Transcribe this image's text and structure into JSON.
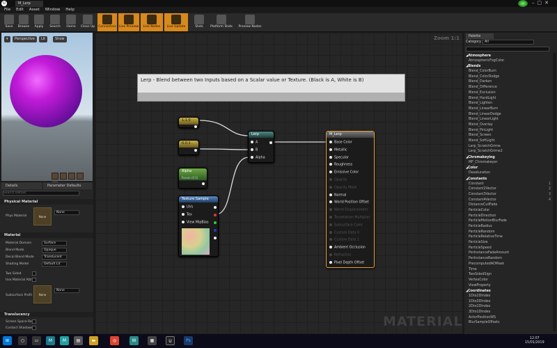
{
  "window": {
    "tab_title": "M_Lerp"
  },
  "menu": [
    "File",
    "Edit",
    "Asset",
    "Window",
    "Help"
  ],
  "toolbar": [
    {
      "label": "Save",
      "icon": "save-icon",
      "active": false
    },
    {
      "label": "Browse",
      "icon": "browse-icon",
      "active": false
    },
    {
      "label": "Apply",
      "icon": "apply-icon",
      "active": false
    },
    {
      "label": "Search",
      "icon": "search-icon",
      "active": false
    },
    {
      "label": "Home",
      "icon": "home-icon",
      "active": false
    },
    {
      "label": "Clean Up",
      "icon": "cleanup-icon",
      "active": false
    },
    {
      "label": "Connectors",
      "icon": "connectors-icon",
      "active": true
    },
    {
      "label": "Live Preview",
      "icon": "live-preview-icon",
      "active": true
    },
    {
      "label": "Live Nodes",
      "icon": "live-nodes-icon",
      "active": true
    },
    {
      "label": "Live Update",
      "icon": "live-update-icon",
      "active": true
    },
    {
      "label": "Stats",
      "icon": "stats-icon",
      "active": false
    },
    {
      "label": "Platform Stats",
      "icon": "platform-stats-icon",
      "active": false
    },
    {
      "label": "Preview Nodes",
      "icon": "preview-nodes-icon",
      "active": false
    }
  ],
  "viewport": {
    "perspective": "Perspective",
    "lit": "Lit",
    "show": "Show"
  },
  "details": {
    "tab_details": "Details",
    "tab_param": "Parameter Defaults",
    "search_placeholder": "Search Details",
    "sections": {
      "physical": "Physical Material",
      "material": "Material",
      "translucency": "Translucency"
    },
    "phys_material_label": "Phys Material",
    "none": "None",
    "props": [
      {
        "label": "Material Domain",
        "value": "Surface"
      },
      {
        "label": "Blend Mode",
        "value": "Opaque"
      },
      {
        "label": "Decal Blend Mode",
        "value": "Translucent"
      },
      {
        "label": "Shading Model",
        "value": "Default Lit"
      }
    ],
    "checks": [
      "Two Sided",
      "Use Material Attri"
    ],
    "subsurface_label": "Subsurface Profil",
    "trans_checks": [
      "Screen Space Ref",
      "Contact Shadows"
    ]
  },
  "graph": {
    "zoom": "Zoom 1:1",
    "watermark": "MATERIAL",
    "comment": "Lerp - Blend between two Inputs based on a Scalar value or Texture.  (Black is A, White is B)",
    "const1": {
      "title": "1,1,0"
    },
    "const2": {
      "title": "0,0,1"
    },
    "alpha": {
      "title": "Alpha",
      "subtitle": "Param (0.5)"
    },
    "texture": {
      "title": "Texture Sample",
      "pins": [
        "UVs",
        "Tex",
        "View MipBias"
      ]
    },
    "lerp": {
      "title": "Lerp",
      "pins": [
        "A",
        "B",
        "Alpha"
      ]
    },
    "result": {
      "title": "M_Lerp",
      "pins": [
        {
          "label": "Base Color",
          "active": true
        },
        {
          "label": "Metallic",
          "active": true
        },
        {
          "label": "Specular",
          "active": true
        },
        {
          "label": "Roughness",
          "active": true
        },
        {
          "label": "Emissive Color",
          "active": true
        },
        {
          "label": "Opacity",
          "active": false
        },
        {
          "label": "Opacity Mask",
          "active": false
        },
        {
          "label": "Normal",
          "active": true
        },
        {
          "label": "World Position Offset",
          "active": true
        },
        {
          "label": "World Displacement",
          "active": false
        },
        {
          "label": "Tessellation Multiplier",
          "active": false
        },
        {
          "label": "Subsurface Color",
          "active": false
        },
        {
          "label": "Custom Data 0",
          "active": false
        },
        {
          "label": "Custom Data 1",
          "active": false
        },
        {
          "label": "Ambient Occlusion",
          "active": true
        },
        {
          "label": "Refraction",
          "active": false
        },
        {
          "label": "Pixel Depth Offset",
          "active": true
        }
      ]
    }
  },
  "palette": {
    "tab": "Palette",
    "category_label": "Category",
    "category_value": "All",
    "items": [
      {
        "t": "Atmosphere",
        "cat": true
      },
      {
        "t": "AtmosphericFogColor"
      },
      {
        "t": "Blends",
        "cat": true
      },
      {
        "t": "Blend_ColorBurn"
      },
      {
        "t": "Blend_ColorDodge"
      },
      {
        "t": "Blend_Darken"
      },
      {
        "t": "Blend_Difference"
      },
      {
        "t": "Blend_Exclusion"
      },
      {
        "t": "Blend_HardLight"
      },
      {
        "t": "Blend_Lighten"
      },
      {
        "t": "Blend_LinearBurn"
      },
      {
        "t": "Blend_LinearDodge"
      },
      {
        "t": "Blend_LinearLight"
      },
      {
        "t": "Blend_Overlay"
      },
      {
        "t": "Blend_PinLight"
      },
      {
        "t": "Blend_Screen"
      },
      {
        "t": "Blend_SoftLight"
      },
      {
        "t": "Lerp_ScratchGrime"
      },
      {
        "t": "Lerp_ScratchGrime2"
      },
      {
        "t": "Chromakeying",
        "cat": true
      },
      {
        "t": "MF_Chromakeyer"
      },
      {
        "t": "Color",
        "cat": true
      },
      {
        "t": "Desaturation"
      },
      {
        "t": "Constants",
        "cat": true
      },
      {
        "t": "Constant",
        "k": "1"
      },
      {
        "t": "Constant2Vector",
        "k": "2"
      },
      {
        "t": "Constant3Vector",
        "k": "3"
      },
      {
        "t": "Constant4Vector",
        "k": "4"
      },
      {
        "t": "DistanceCullFade"
      },
      {
        "t": "ParticleColor"
      },
      {
        "t": "ParticleDirection"
      },
      {
        "t": "ParticleMotionBlurFade"
      },
      {
        "t": "ParticleRadius"
      },
      {
        "t": "ParticleRandom"
      },
      {
        "t": "ParticleRelativeTime"
      },
      {
        "t": "ParticleSize"
      },
      {
        "t": "ParticleSpeed"
      },
      {
        "t": "PerInstanceFadeAmount"
      },
      {
        "t": "PerInstanceRandom"
      },
      {
        "t": "PrecomputedAOMask"
      },
      {
        "t": "Time"
      },
      {
        "t": "TwoSidedSign"
      },
      {
        "t": "VertexColor"
      },
      {
        "t": "ViewProperty"
      },
      {
        "t": "Coordinates",
        "cat": true
      },
      {
        "t": "1Dto2DIndex"
      },
      {
        "t": "1Dto3DIndex"
      },
      {
        "t": "2Dto1DIndex"
      },
      {
        "t": "3Dto1DIndex"
      },
      {
        "t": "ActorPositionWS"
      },
      {
        "t": "BlurSampleOffsets"
      }
    ]
  },
  "clock": {
    "time": "12:07",
    "date": "15/01/2019"
  }
}
